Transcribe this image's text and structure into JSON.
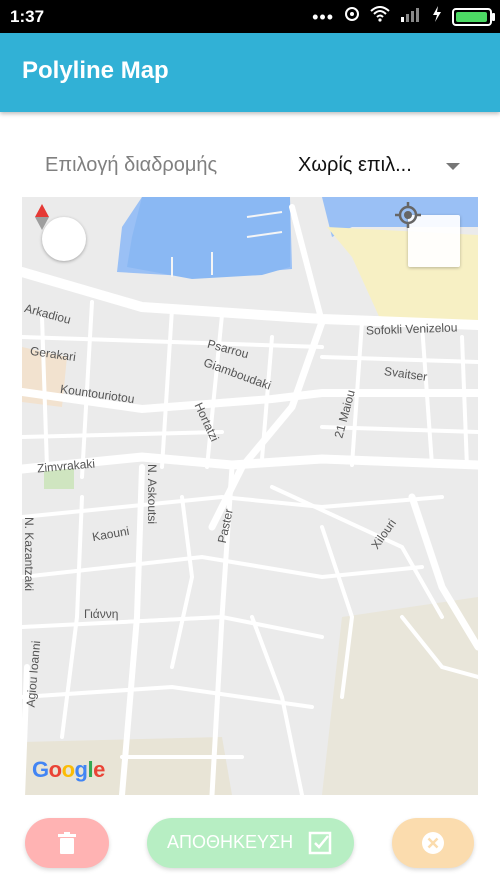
{
  "status_bar": {
    "time": "1:37",
    "icons": [
      "more-dots-icon",
      "hotspot-icon",
      "wifi-icon",
      "signal-icon",
      "charging-icon",
      "battery-icon"
    ]
  },
  "app_bar": {
    "title": "Polyline Map",
    "color": "#31b1d6"
  },
  "route_selector": {
    "label": "Επιλογή διαδρομής",
    "selected_value": "Χωρίς επιλ..."
  },
  "map": {
    "street_labels": [
      "Arkadiou",
      "Gerakari",
      "Psarrou",
      "Giamboudaki",
      "Sofokli Venizelou",
      "Svaitser",
      "Kountouriotou",
      "Hortatzi",
      "21 Maiou",
      "Zimvrakaki",
      "N. Askoutsi",
      "Kaouni",
      "Paster",
      "Xilouri",
      "N. Kazantzaki",
      "Γιάννη",
      "Agiou Ioanni"
    ],
    "attribution": "Google"
  },
  "actions": {
    "save_label": "ΑΠΟΘΗΚΕΥΣΗ",
    "delete_color": "#ffb3b3",
    "save_color": "#b7eec3",
    "cancel_color": "#fbdcae"
  }
}
